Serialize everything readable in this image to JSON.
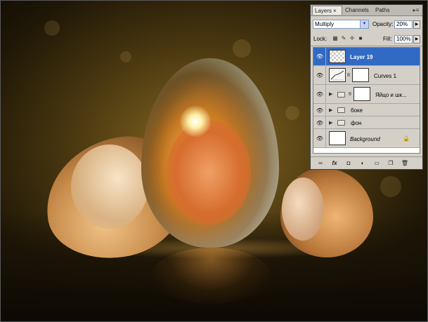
{
  "panel": {
    "tabs": [
      {
        "label": "Layers",
        "active": true
      },
      {
        "label": "Channels",
        "active": false
      },
      {
        "label": "Paths",
        "active": false
      }
    ],
    "close_glyph": "×",
    "menu_glyph": "▸≡",
    "blend_mode": "Multiply",
    "opacity_label": "Opacity:",
    "opacity_value": "20%",
    "lock_label": "Lock:",
    "fill_label": "Fill:",
    "fill_value": "100%",
    "layers": [
      {
        "name": "Layer 19",
        "selected": true,
        "type": "pixel"
      },
      {
        "name": "Curves 1",
        "selected": false,
        "type": "adjustment"
      },
      {
        "name": "Яйцо и шк...",
        "selected": false,
        "type": "group-masked"
      },
      {
        "name": "боке",
        "selected": false,
        "type": "group"
      },
      {
        "name": "фон",
        "selected": false,
        "type": "group"
      },
      {
        "name": "Background",
        "selected": false,
        "type": "background"
      }
    ],
    "bottom_icons": [
      "link-icon",
      "fx-icon",
      "mask-icon",
      "adjustment-icon",
      "folder-icon",
      "new-layer-icon",
      "trash-icon"
    ]
  },
  "colors": {
    "selection": "#316ac5",
    "panel_bg": "#d4d0c8",
    "canvas_glow": "#8a6a22"
  }
}
